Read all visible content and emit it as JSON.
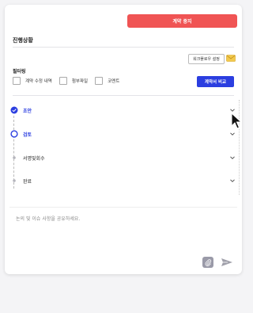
{
  "header": {
    "stop_button": "계약 중지",
    "title": "진행상황",
    "workflow_button": "워크플로우 설정"
  },
  "filters": {
    "label": "필터링",
    "options": [
      {
        "label": "계약 수정 내역",
        "checked": false
      },
      {
        "label": "첨부파일",
        "checked": false
      },
      {
        "label": "코멘트",
        "checked": false
      }
    ],
    "compare_button": "계약서 비교"
  },
  "steps": [
    {
      "label": "초안",
      "state": "done"
    },
    {
      "label": "검토",
      "state": "current"
    },
    {
      "label": "서명및회수",
      "state": "pending"
    },
    {
      "label": "완료",
      "state": "pending"
    }
  ],
  "comment": {
    "placeholder": "논의 및 이슈 사항을 공유하세요."
  },
  "colors": {
    "danger": "#f05454",
    "primary": "#2b3ee0",
    "mail": "#f2c94c"
  }
}
